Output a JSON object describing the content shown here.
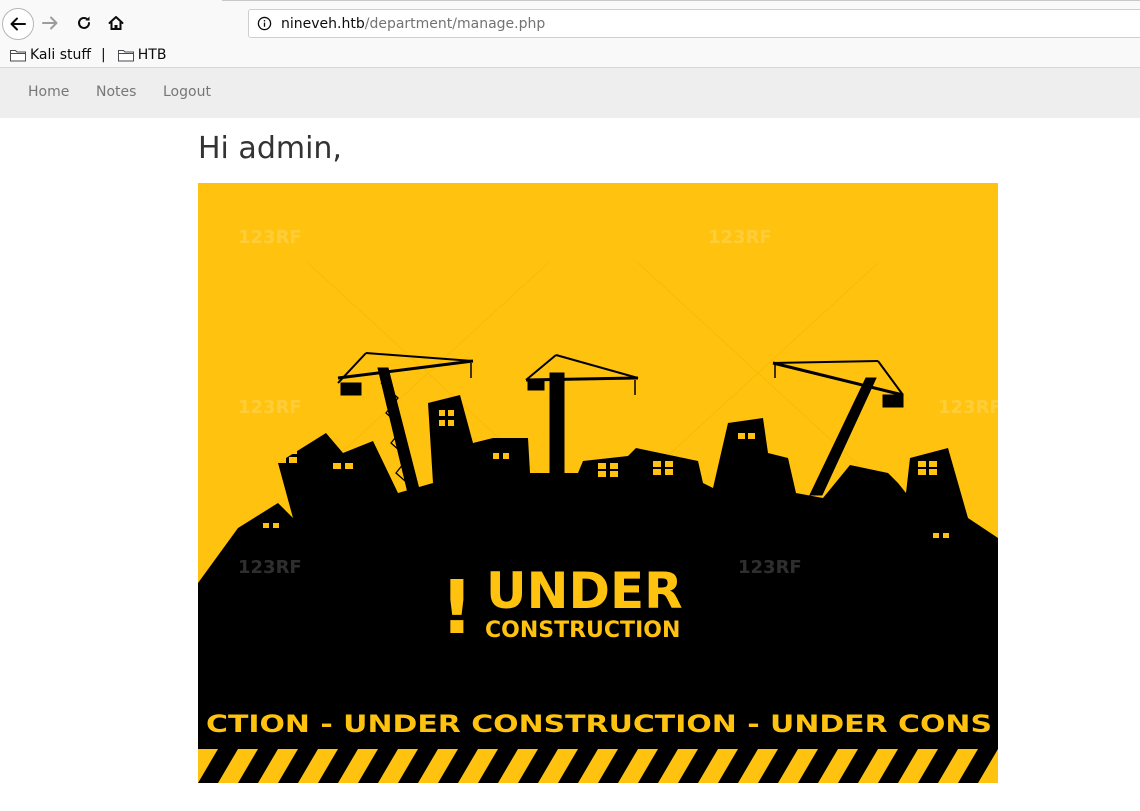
{
  "browser": {
    "url_host": "nineveh.htb",
    "url_path": "/department/manage.php",
    "bookmarks": [
      {
        "label": "Kali stuff",
        "icon": "folder-icon"
      },
      {
        "label": "HTB",
        "icon": "folder-icon"
      }
    ],
    "bookmark_separator": "|"
  },
  "nav": {
    "items": [
      {
        "label": "Home"
      },
      {
        "label": "Notes"
      },
      {
        "label": "Logout"
      }
    ]
  },
  "main": {
    "greeting": "Hi admin,",
    "banner": {
      "main_text": "UNDER",
      "sub_text": "CONSTRUCTION",
      "ribbon_text": "CTION - UNDER  CONSTRUCTION - UNDER  CONS",
      "exclamation": "!",
      "watermark": "123RF",
      "colors": {
        "yellow": "#ffc20e",
        "black": "#000000"
      }
    }
  }
}
